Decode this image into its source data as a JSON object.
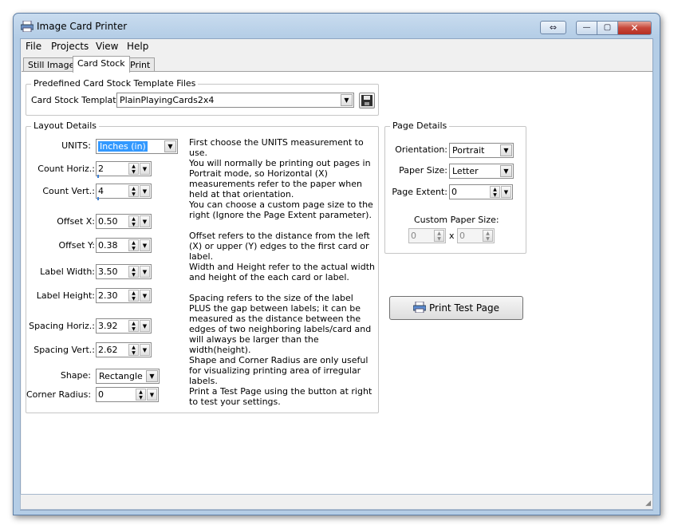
{
  "window": {
    "title": "Image Card Printer",
    "controls": {
      "minimize": "—",
      "maximize": "▢",
      "close": "✕",
      "resize": "⇔"
    }
  },
  "menu": [
    {
      "label": "File"
    },
    {
      "label": "Projects"
    },
    {
      "label": "View"
    },
    {
      "label": "Help"
    }
  ],
  "tabs": [
    {
      "label": "Still Images",
      "active": false
    },
    {
      "label": "Card Stock",
      "active": true
    },
    {
      "label": "Print",
      "active": false
    }
  ],
  "template_group": {
    "title": "Predefined Card Stock Template Files",
    "label": "Card Stock Template:",
    "value": "PlainPlayingCards2x4",
    "save_icon": "floppy-disk-icon"
  },
  "layout": {
    "title": "Layout Details",
    "units": {
      "label": "UNITS:",
      "value": "Inches (in)"
    },
    "count_horiz": {
      "label": "Count Horiz.:",
      "value": "2"
    },
    "count_vert": {
      "label": "Count Vert.:",
      "value": "4"
    },
    "offset_x": {
      "label": "Offset X:",
      "value": "0.50"
    },
    "offset_y": {
      "label": "Offset Y:",
      "value": "0.38"
    },
    "label_width": {
      "label": "Label Width:",
      "value": "3.50"
    },
    "label_height": {
      "label": "Label Height:",
      "value": "2.30"
    },
    "spacing_horiz": {
      "label": "Spacing Horiz.:",
      "value": "3.92"
    },
    "spacing_vert": {
      "label": "Spacing Vert.:",
      "value": "2.62"
    },
    "shape": {
      "label": "Shape:",
      "value": "Rectangle"
    },
    "corner_radius": {
      "label": "Corner Radius:",
      "value": "0"
    },
    "help": [
      "First choose the UNITS measurement to use.",
      "You will normally be printing out pages in Portrait mode, so Horizontal (X) measurements refer to the paper when held at that orientation.",
      "You can choose a custom page size to the right (Ignore the Page Extent parameter).",
      "Offset refers to the distance from the left (X) or upper (Y) edges to the first card or label.",
      "Width and Height refer to the actual width and height of the each card or label.",
      "Spacing refers to the size of the label PLUS the gap between labels; it can be measured as the distance between the edges of two neighboring labels/card and will always be larger than the width(height).",
      "Shape and Corner Radius are only useful for visualizing printing area of irregular labels.",
      "Print a Test Page using the button at right to test your settings."
    ]
  },
  "page": {
    "title": "Page Details",
    "orientation": {
      "label": "Orientation:",
      "value": "Portrait"
    },
    "paper_size": {
      "label": "Paper Size:",
      "value": "Letter"
    },
    "page_extent": {
      "label": "Page Extent:",
      "value": "0"
    },
    "custom_label": "Custom Paper Size:",
    "custom_w": "0",
    "custom_h": "0",
    "x_sep": "x"
  },
  "print_test": {
    "label": "Print Test Page",
    "icon": "printer-icon"
  },
  "status": {
    "text": ""
  }
}
